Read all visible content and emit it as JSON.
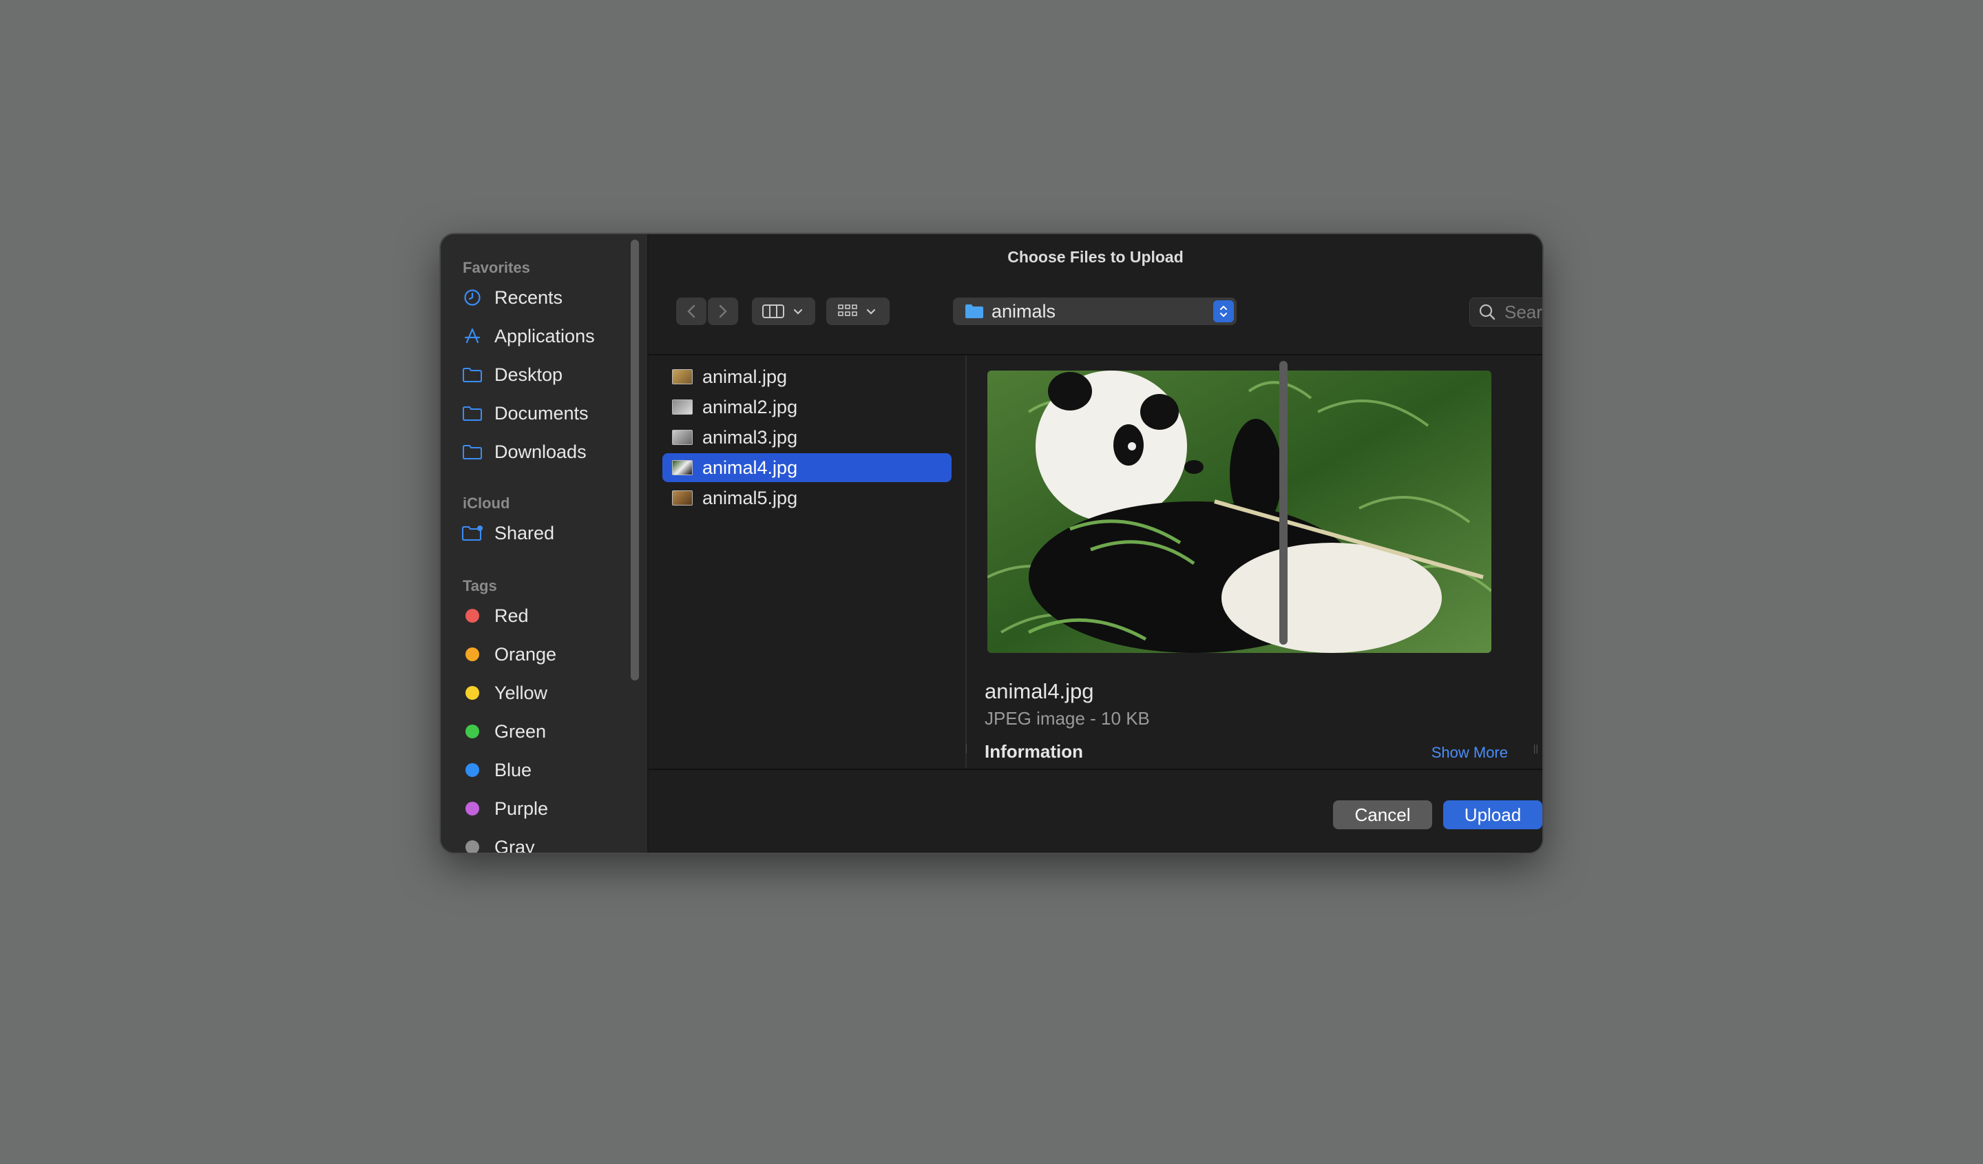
{
  "dialog_title": "Choose Files to Upload",
  "sidebar": {
    "favorites_heading": "Favorites",
    "favorites": [
      {
        "label": "Recents",
        "icon": "clock-icon"
      },
      {
        "label": "Applications",
        "icon": "applications-icon"
      },
      {
        "label": "Desktop",
        "icon": "folder-icon"
      },
      {
        "label": "Documents",
        "icon": "folder-icon"
      },
      {
        "label": "Downloads",
        "icon": "folder-icon"
      }
    ],
    "icloud_heading": "iCloud",
    "icloud": [
      {
        "label": "Shared",
        "icon": "shared-folder-icon"
      }
    ],
    "tags_heading": "Tags",
    "tags": [
      {
        "label": "Red",
        "color": "#ec5b56"
      },
      {
        "label": "Orange",
        "color": "#f5a623"
      },
      {
        "label": "Yellow",
        "color": "#f7d02a"
      },
      {
        "label": "Green",
        "color": "#3fc84a"
      },
      {
        "label": "Blue",
        "color": "#2f8df5"
      },
      {
        "label": "Purple",
        "color": "#c263db"
      },
      {
        "label": "Gray",
        "color": "#8e8e8e"
      }
    ]
  },
  "toolbar": {
    "location": "animals",
    "search_placeholder": "Search"
  },
  "files": [
    {
      "name": "animal.jpg",
      "selected": false
    },
    {
      "name": "animal2.jpg",
      "selected": false
    },
    {
      "name": "animal3.jpg",
      "selected": false
    },
    {
      "name": "animal4.jpg",
      "selected": true
    },
    {
      "name": "animal5.jpg",
      "selected": false
    }
  ],
  "preview": {
    "name": "animal4.jpg",
    "kind": "JPEG image - 10 KB",
    "info_heading": "Information",
    "show_more": "Show More"
  },
  "buttons": {
    "cancel": "Cancel",
    "upload": "Upload"
  },
  "colors": {
    "accent": "#2f68d8",
    "selection": "#2857d6",
    "link": "#4b8df8"
  }
}
